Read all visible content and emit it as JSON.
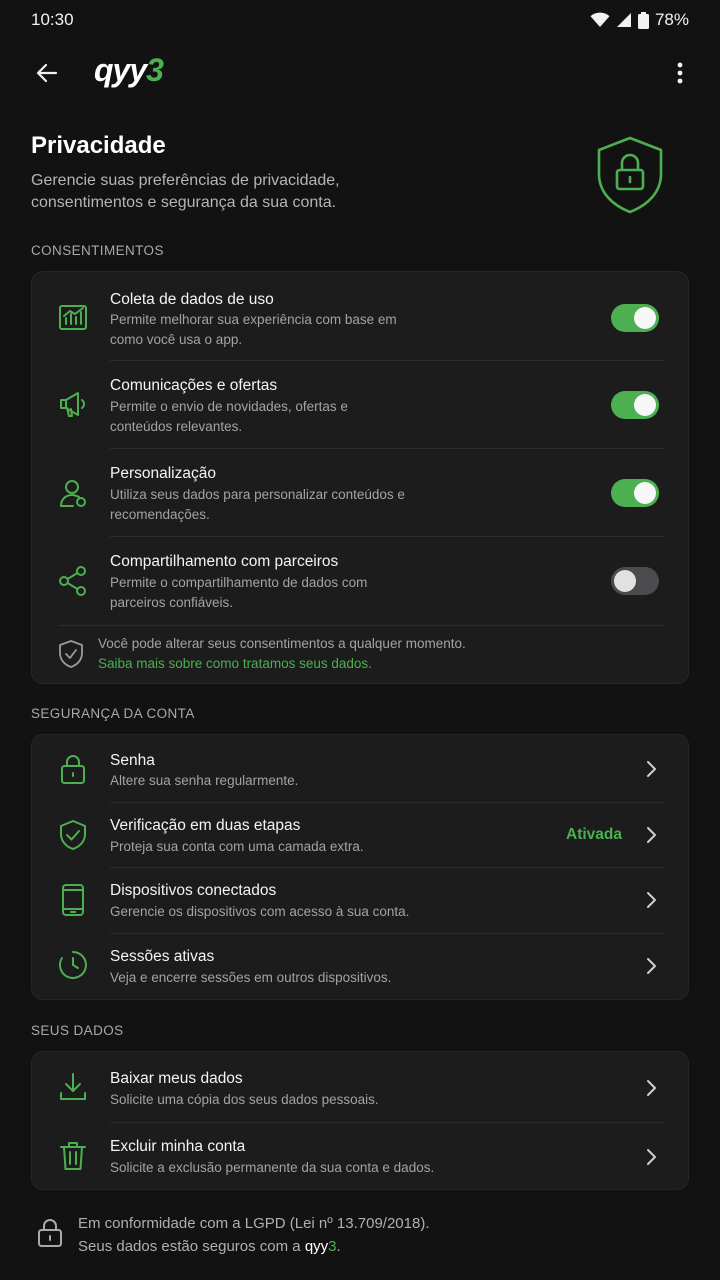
{
  "status_bar": {
    "time": "10:30",
    "battery": "78%"
  },
  "app_bar": {
    "logo_main": "qyy",
    "logo_accent": "3"
  },
  "header": {
    "title": "Privacidade",
    "subtitle": "Gerencie suas preferências de privacidade, consentimentos e segurança da sua conta."
  },
  "consents": {
    "section_label": "CONSENTIMENTOS",
    "items": [
      {
        "title": "Coleta de dados de uso",
        "desc": "Permite melhorar sua experiência com base em como você usa o app.",
        "enabled": true,
        "icon": "chart-icon"
      },
      {
        "title": "Comunicações e ofertas",
        "desc": "Permite o envio de novidades, ofertas e conteúdos relevantes.",
        "enabled": true,
        "icon": "megaphone-icon"
      },
      {
        "title": "Personalização",
        "desc": "Utiliza seus dados para personalizar conteúdos e recomendações.",
        "enabled": true,
        "icon": "user-icon"
      },
      {
        "title": "Compartilhamento com parceiros",
        "desc": "Permite o compartilhamento de dados com parceiros confiáveis.",
        "enabled": false,
        "icon": "share-icon"
      }
    ],
    "note": "Você pode alterar seus consentimentos a qualquer momento.",
    "note_link": "Saiba mais sobre como tratamos seus dados."
  },
  "security": {
    "section_label": "SEGURANÇA DA CONTA",
    "items": [
      {
        "title": "Senha",
        "desc": "Altere sua senha regularmente.",
        "icon": "lock-icon"
      },
      {
        "title": "Verificação em duas etapas",
        "desc": "Proteja sua conta com uma camada extra.",
        "status": "Ativada",
        "icon": "shield-check-icon"
      },
      {
        "title": "Dispositivos conectados",
        "desc": "Gerencie os dispositivos com acesso à sua conta.",
        "icon": "phone-icon"
      },
      {
        "title": "Sessões ativas",
        "desc": "Veja e encerre sessões em outros dispositivos.",
        "icon": "clock-icon"
      }
    ]
  },
  "your_data": {
    "section_label": "SEUS DADOS",
    "items": [
      {
        "title": "Baixar meus dados",
        "desc": "Solicite uma cópia dos seus dados pessoais.",
        "icon": "download-icon"
      },
      {
        "title": "Excluir minha conta",
        "desc": "Solicite a exclusão permanente da sua conta e dados.",
        "icon": "trash-icon"
      }
    ]
  },
  "footer": {
    "line1": "Em conformidade com a LGPD (Lei nº 13.709/2018).",
    "line2_prefix": "Seus dados estão seguros com a ",
    "brand_main": "qyy",
    "brand_accent": "3",
    "line2_suffix": "."
  },
  "colors": {
    "accent": "#4cb050",
    "background": "#121212",
    "card": "#1c1c1d"
  }
}
